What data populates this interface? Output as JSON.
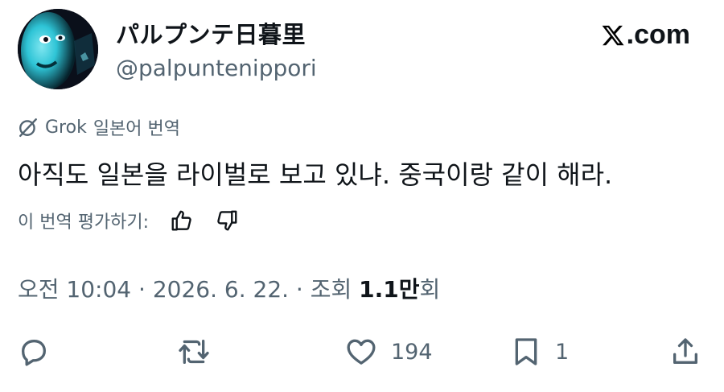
{
  "author": {
    "display_name": "パルプンテ日暮里",
    "handle": "@palpuntenippori"
  },
  "brand": {
    "text": ".com"
  },
  "translation": {
    "provider": "Grok",
    "label": "일본어 번역"
  },
  "tweet": {
    "text": "아직도 일본을 라이벌로 보고 있냐. 중국이랑 같이 해라."
  },
  "rate": {
    "label": "이 번역 평가하기:"
  },
  "meta": {
    "time": "오전 10:04",
    "sep1": " · ",
    "date": "2026. 6. 22.",
    "sep2": " · ",
    "views_label": "조회 ",
    "views_count": "1.1만",
    "views_suffix": "회"
  },
  "actions": {
    "reply_count": "",
    "retweet_count": "",
    "like_count": "194",
    "bookmark_count": "1"
  },
  "icons": [
    "x-logo-icon",
    "grok-icon",
    "thumbs-up-icon",
    "thumbs-down-icon",
    "reply-icon",
    "retweet-icon",
    "like-icon",
    "bookmark-icon",
    "share-icon"
  ],
  "colors": {
    "text": "#0f1419",
    "muted": "#536471",
    "avatar_glow": "#2ec4d6"
  }
}
